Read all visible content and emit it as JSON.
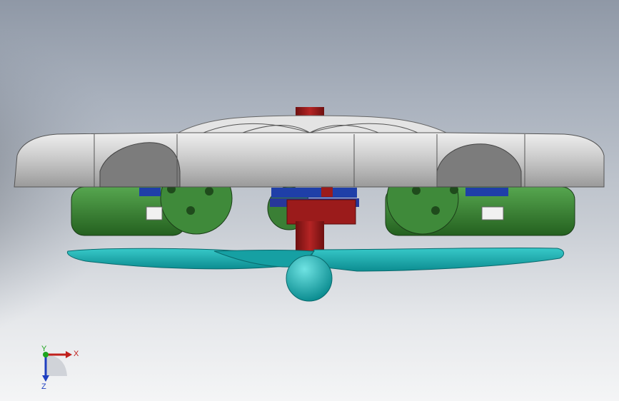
{
  "viewport": {
    "background": {
      "top": "#8f98a6",
      "bottom": "#f4f5f6"
    }
  },
  "model": {
    "colors": {
      "housing": "#c9c9c9",
      "housing_dark": "#8e8e8e",
      "motor": "#3f8a3a",
      "motor_dark": "#245a22",
      "gear": "#1f3fa8",
      "shaft": "#9b1b1b",
      "blade": "#1fb3b3",
      "blade_dark": "#0b7c80"
    }
  },
  "triad": {
    "x_label": "X",
    "y_label": "Y",
    "z_label": "Z",
    "x_color": "#c0201c",
    "y_color": "#1fa51f",
    "z_color": "#1f3fc0"
  }
}
